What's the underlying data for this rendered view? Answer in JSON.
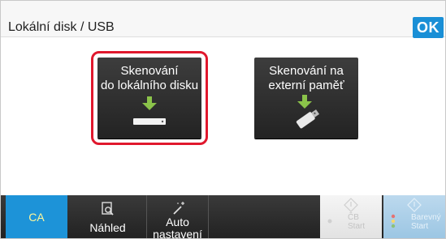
{
  "header": {
    "title": "Lokální disk / USB",
    "ok_label": "OK"
  },
  "tiles": [
    {
      "line1": "Skenování",
      "line2": "do lokálního disku",
      "selected": true,
      "icon": "download-to-disk-icon"
    },
    {
      "line1": "Skenování na",
      "line2": "externí paměť",
      "selected": false,
      "icon": "download-to-usb-icon"
    }
  ],
  "taskbar": {
    "ca_label": "CA",
    "preview_label": "Náhled",
    "auto_label_1": "Auto",
    "auto_label_2": "nastavení",
    "bw_start_1": "ČB",
    "bw_start_2": "Start",
    "color_start_1": "Barevný",
    "color_start_2": "Start"
  },
  "colors": {
    "accent": "#1a8fd6",
    "selection": "#e0182d",
    "tile": "#2e2e2e"
  }
}
